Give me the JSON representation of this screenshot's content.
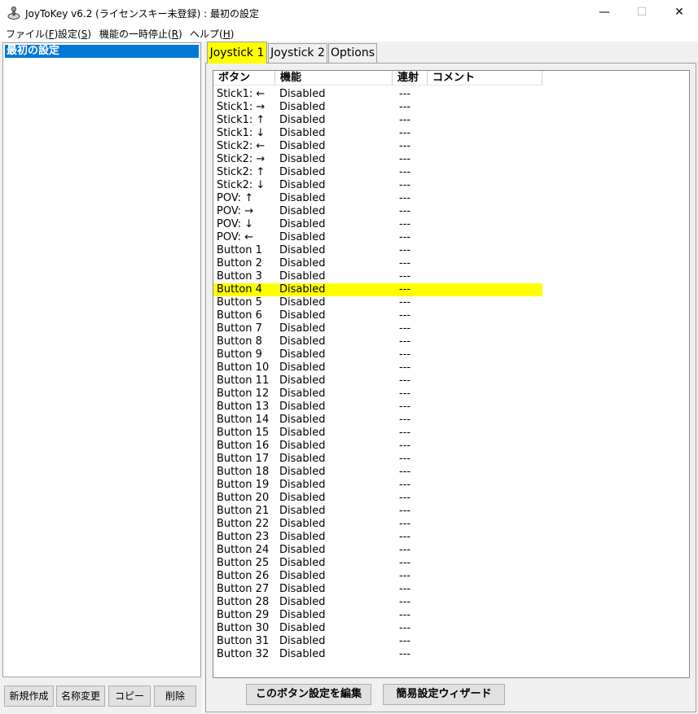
{
  "window": {
    "title": "JoyToKey v6.2 (ライセンスキー未登録) : 最初の設定",
    "minimize": "—",
    "maximize": "☐",
    "close": "✕"
  },
  "menu": [
    {
      "label": "ファイル(",
      "key": "F",
      "end": ")"
    },
    {
      "label": "設定(",
      "key": "S",
      "end": ")"
    },
    {
      "label": "機能の一時停止(",
      "key": "R",
      "end": ")"
    },
    {
      "label": "ヘルプ(",
      "key": "H",
      "end": ")"
    }
  ],
  "profiles": {
    "items": [
      "最初の設定"
    ],
    "buttons": {
      "new": "新規作成",
      "rename": "名称変更",
      "copy": "コピー",
      "delete": "削除"
    }
  },
  "tabs": [
    "Joystick 1",
    "Joystick 2",
    "Options"
  ],
  "list": {
    "columns": [
      "ボタン",
      "機能",
      "連射",
      "コメント"
    ],
    "rows": [
      {
        "button": "Stick1: ←",
        "function": "Disabled",
        "rapid": "---",
        "comment": ""
      },
      {
        "button": "Stick1: →",
        "function": "Disabled",
        "rapid": "---",
        "comment": ""
      },
      {
        "button": "Stick1: ↑",
        "function": "Disabled",
        "rapid": "---",
        "comment": ""
      },
      {
        "button": "Stick1: ↓",
        "function": "Disabled",
        "rapid": "---",
        "comment": ""
      },
      {
        "button": "Stick2: ←",
        "function": "Disabled",
        "rapid": "---",
        "comment": ""
      },
      {
        "button": "Stick2: →",
        "function": "Disabled",
        "rapid": "---",
        "comment": ""
      },
      {
        "button": "Stick2: ↑",
        "function": "Disabled",
        "rapid": "---",
        "comment": ""
      },
      {
        "button": "Stick2: ↓",
        "function": "Disabled",
        "rapid": "---",
        "comment": ""
      },
      {
        "button": "POV: ↑",
        "function": "Disabled",
        "rapid": "---",
        "comment": ""
      },
      {
        "button": "POV: →",
        "function": "Disabled",
        "rapid": "---",
        "comment": ""
      },
      {
        "button": "POV: ↓",
        "function": "Disabled",
        "rapid": "---",
        "comment": ""
      },
      {
        "button": "POV: ←",
        "function": "Disabled",
        "rapid": "---",
        "comment": ""
      },
      {
        "button": "Button 1",
        "function": "Disabled",
        "rapid": "---",
        "comment": ""
      },
      {
        "button": "Button 2",
        "function": "Disabled",
        "rapid": "---",
        "comment": ""
      },
      {
        "button": "Button 3",
        "function": "Disabled",
        "rapid": "---",
        "comment": ""
      },
      {
        "button": "Button 4",
        "function": "Disabled",
        "rapid": "---",
        "comment": "",
        "selected": true
      },
      {
        "button": "Button 5",
        "function": "Disabled",
        "rapid": "---",
        "comment": ""
      },
      {
        "button": "Button 6",
        "function": "Disabled",
        "rapid": "---",
        "comment": ""
      },
      {
        "button": "Button 7",
        "function": "Disabled",
        "rapid": "---",
        "comment": ""
      },
      {
        "button": "Button 8",
        "function": "Disabled",
        "rapid": "---",
        "comment": ""
      },
      {
        "button": "Button 9",
        "function": "Disabled",
        "rapid": "---",
        "comment": ""
      },
      {
        "button": "Button 10",
        "function": "Disabled",
        "rapid": "---",
        "comment": ""
      },
      {
        "button": "Button 11",
        "function": "Disabled",
        "rapid": "---",
        "comment": ""
      },
      {
        "button": "Button 12",
        "function": "Disabled",
        "rapid": "---",
        "comment": ""
      },
      {
        "button": "Button 13",
        "function": "Disabled",
        "rapid": "---",
        "comment": ""
      },
      {
        "button": "Button 14",
        "function": "Disabled",
        "rapid": "---",
        "comment": ""
      },
      {
        "button": "Button 15",
        "function": "Disabled",
        "rapid": "---",
        "comment": ""
      },
      {
        "button": "Button 16",
        "function": "Disabled",
        "rapid": "---",
        "comment": ""
      },
      {
        "button": "Button 17",
        "function": "Disabled",
        "rapid": "---",
        "comment": ""
      },
      {
        "button": "Button 18",
        "function": "Disabled",
        "rapid": "---",
        "comment": ""
      },
      {
        "button": "Button 19",
        "function": "Disabled",
        "rapid": "---",
        "comment": ""
      },
      {
        "button": "Button 20",
        "function": "Disabled",
        "rapid": "---",
        "comment": ""
      },
      {
        "button": "Button 21",
        "function": "Disabled",
        "rapid": "---",
        "comment": ""
      },
      {
        "button": "Button 22",
        "function": "Disabled",
        "rapid": "---",
        "comment": ""
      },
      {
        "button": "Button 23",
        "function": "Disabled",
        "rapid": "---",
        "comment": ""
      },
      {
        "button": "Button 24",
        "function": "Disabled",
        "rapid": "---",
        "comment": ""
      },
      {
        "button": "Button 25",
        "function": "Disabled",
        "rapid": "---",
        "comment": ""
      },
      {
        "button": "Button 26",
        "function": "Disabled",
        "rapid": "---",
        "comment": ""
      },
      {
        "button": "Button 27",
        "function": "Disabled",
        "rapid": "---",
        "comment": ""
      },
      {
        "button": "Button 28",
        "function": "Disabled",
        "rapid": "---",
        "comment": ""
      },
      {
        "button": "Button 29",
        "function": "Disabled",
        "rapid": "---",
        "comment": ""
      },
      {
        "button": "Button 30",
        "function": "Disabled",
        "rapid": "---",
        "comment": ""
      },
      {
        "button": "Button 31",
        "function": "Disabled",
        "rapid": "---",
        "comment": ""
      },
      {
        "button": "Button 32",
        "function": "Disabled",
        "rapid": "---",
        "comment": ""
      }
    ]
  },
  "actions": {
    "edit": "このボタン設定を編集",
    "wizard": "簡易設定ウィザード"
  },
  "colors": {
    "selection": "#ffff00",
    "active_tab": "#ffff00",
    "profile_highlight": "#0078d7"
  }
}
